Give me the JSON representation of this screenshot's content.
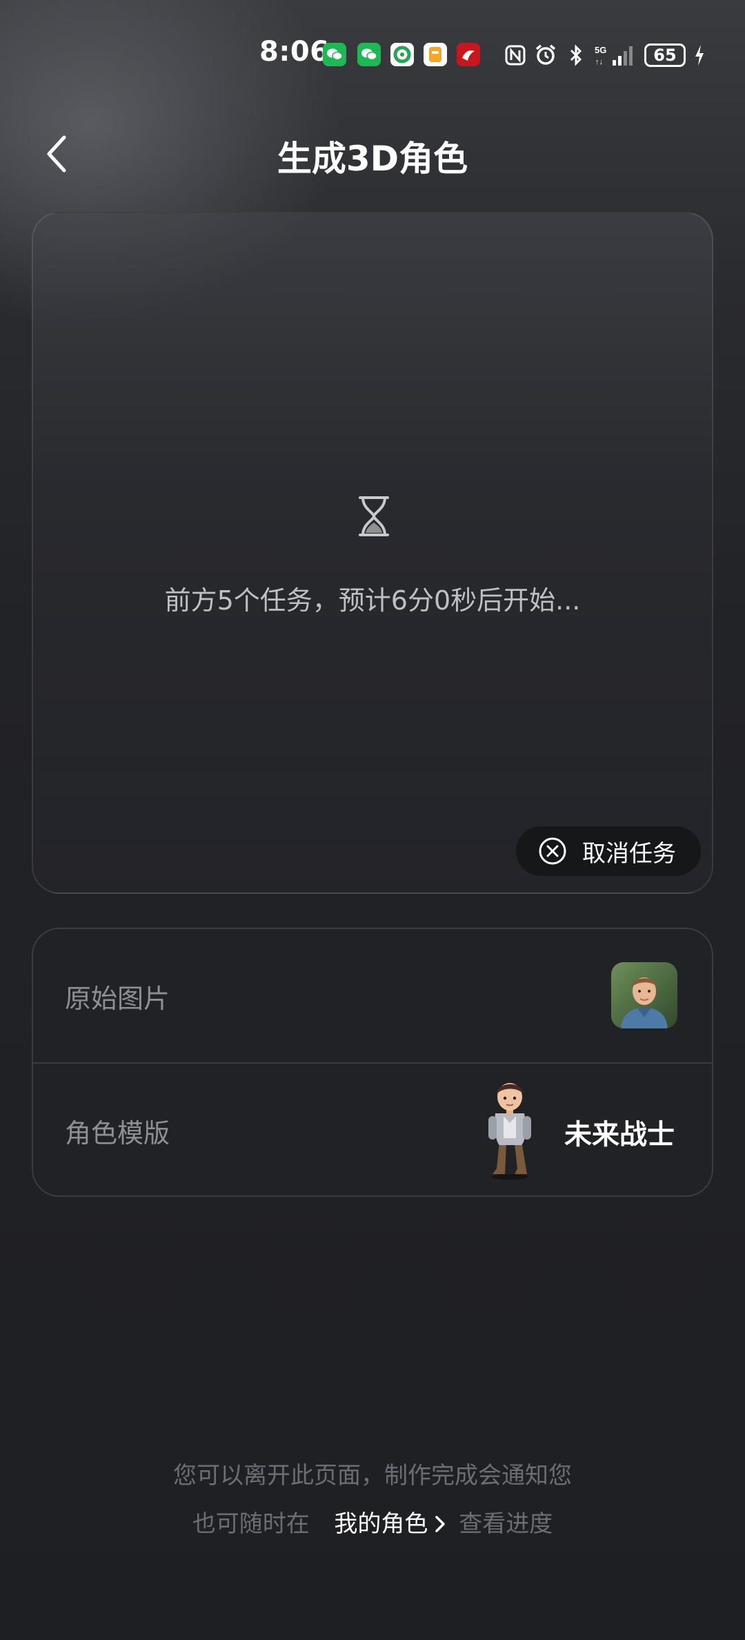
{
  "status_bar": {
    "time": "8:06",
    "notification_icons": [
      "wechat-icon",
      "wechat-icon",
      "green-app-icon",
      "orange-app-icon",
      "red-app-icon"
    ],
    "system_icons": [
      "nfc-icon",
      "alarm-icon",
      "bluetooth-icon",
      "5g-signal-icon"
    ],
    "battery": "65"
  },
  "header": {
    "title": "生成3D角色"
  },
  "preview": {
    "queue_text": "前方5个任务，预计6分0秒后开始...",
    "cancel_label": "取消任务"
  },
  "info": {
    "original_label": "原始图片",
    "template_label": "角色模版",
    "template_name": "未来战士"
  },
  "footer": {
    "line1": "您可以离开此页面，制作完成会通知您",
    "line2_prefix": "也可随时在",
    "link": "我的角色",
    "line2_suffix": "查看进度"
  },
  "colors": {
    "background": "#1f2024",
    "cancel_bg": "#161719",
    "muted_text": "#8e8f94",
    "footer_text": "#6c6d72"
  }
}
